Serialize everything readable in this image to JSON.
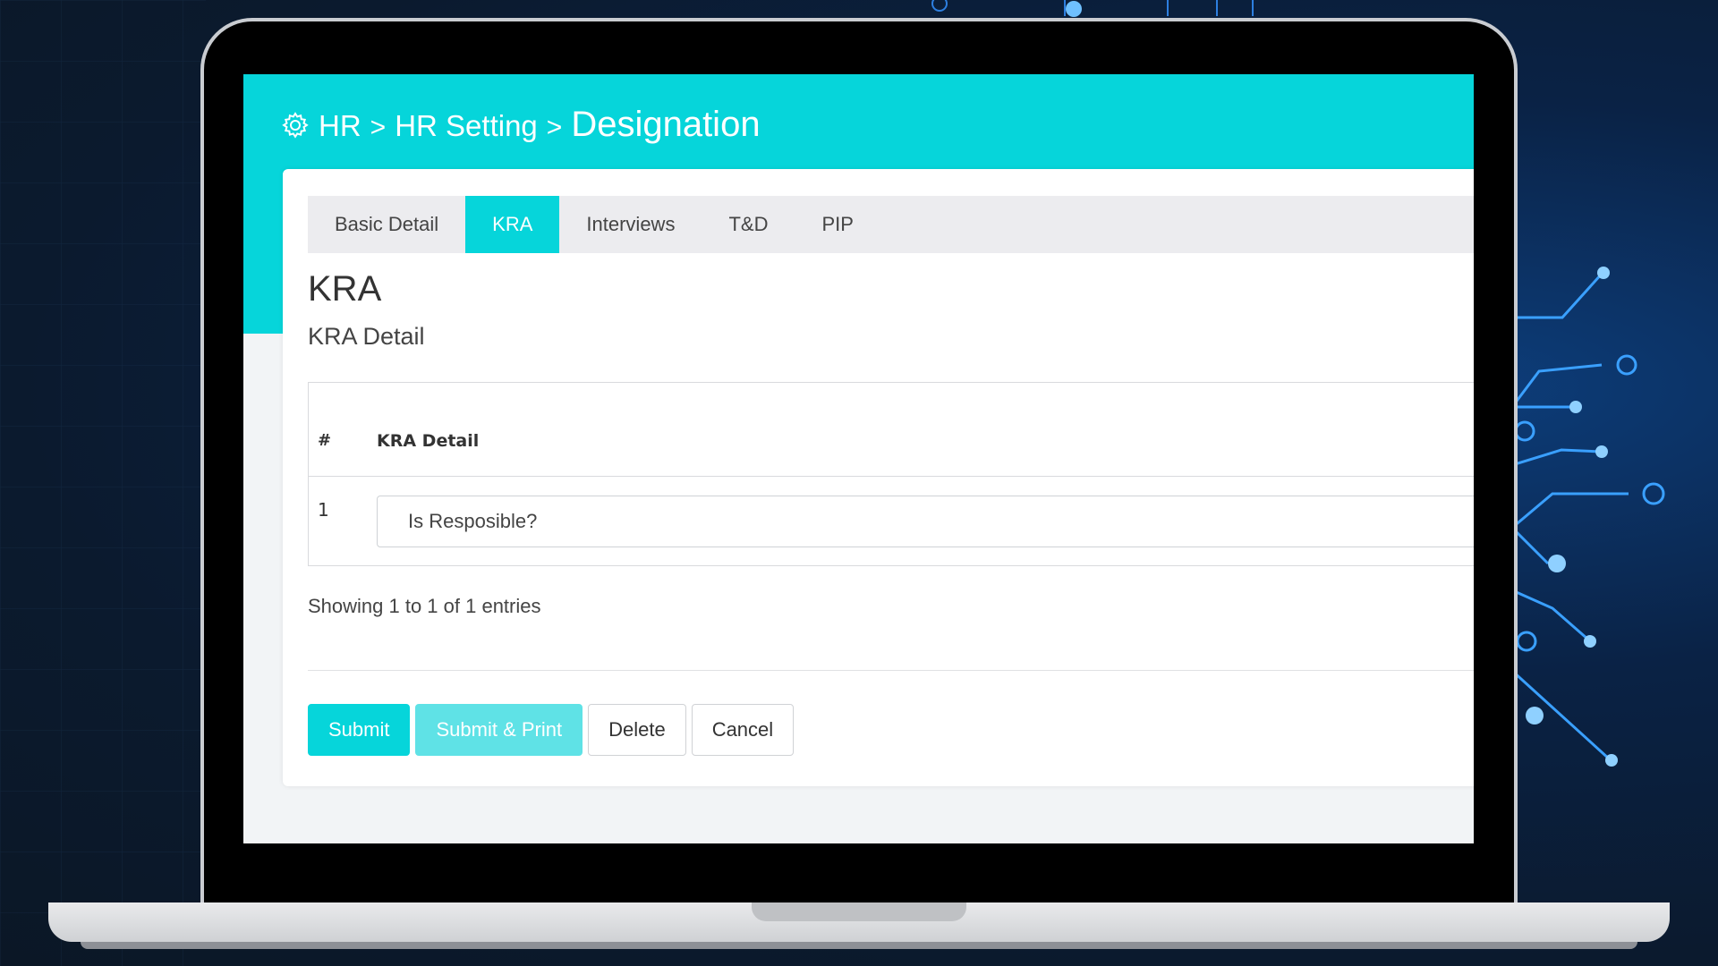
{
  "breadcrumb": {
    "items": [
      "HR",
      "HR Setting"
    ],
    "separator": ">",
    "current": "Designation",
    "icon": "gear-icon"
  },
  "tabs": [
    {
      "label": "Basic Detail",
      "active": false
    },
    {
      "label": "KRA",
      "active": true
    },
    {
      "label": "Interviews",
      "active": false
    },
    {
      "label": "T&D",
      "active": false
    },
    {
      "label": "PIP",
      "active": false
    }
  ],
  "section": {
    "title": "KRA",
    "subtitle": "KRA Detail"
  },
  "table": {
    "headers": [
      "#",
      "KRA Detail"
    ],
    "rows": [
      {
        "num": "1",
        "kra_detail": "Is Resposible?"
      }
    ]
  },
  "pagination": {
    "info": "Showing 1 to 1 of 1 entries"
  },
  "actions": {
    "submit": "Submit",
    "submit_print": "Submit & Print",
    "delete": "Delete",
    "cancel": "Cancel"
  },
  "colors": {
    "accent": "#06d5da",
    "accent_light": "#5fe2e6"
  }
}
